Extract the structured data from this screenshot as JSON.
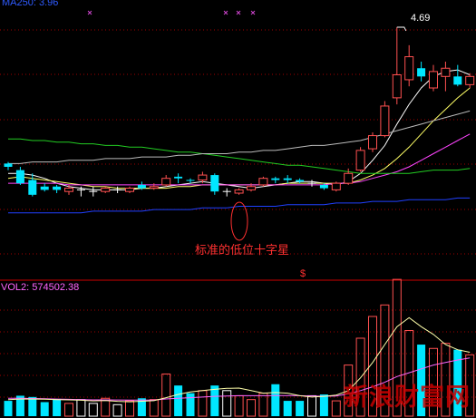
{
  "header": {
    "ma_label": "MA250: 3.96",
    "ma_color": "#2f5bff"
  },
  "annotation": {
    "text": "标准的低位十字星",
    "color": "#ff3030"
  },
  "peak": {
    "text": "4.69"
  },
  "volume": {
    "label": "VOL2: 574502.38",
    "color": "#ff66ff"
  },
  "watermark": {
    "text": "新浪财富网",
    "color": "#c80000"
  },
  "marker": {
    "text": "$",
    "color": "#ff3030"
  },
  "colors": {
    "up": "#ff5050",
    "down": "#00e6ff",
    "doji": "#ffffff",
    "ma5": "#ffffff",
    "ma10": "#ffff66",
    "ma20": "#ff44ff",
    "ma60": "#22cc22",
    "ma120": "#bbbbbb",
    "ma250": "#2040ff",
    "grid": "#a00000"
  },
  "chart_data": [
    {
      "type": "candlestick",
      "title": "",
      "ylim": [
        3.2,
        4.8
      ],
      "grid": true,
      "candles": [
        {
          "o": 3.86,
          "h": 3.87,
          "c": 3.84,
          "l": 3.82,
          "dir": "down"
        },
        {
          "o": 3.82,
          "h": 3.84,
          "c": 3.74,
          "l": 3.73,
          "dir": "down"
        },
        {
          "o": 3.76,
          "h": 3.8,
          "c": 3.67,
          "l": 3.66,
          "dir": "down"
        },
        {
          "o": 3.72,
          "h": 3.74,
          "c": 3.7,
          "l": 3.69,
          "dir": "down"
        },
        {
          "o": 3.72,
          "h": 3.73,
          "c": 3.7,
          "l": 3.68,
          "dir": "down"
        },
        {
          "o": 3.71,
          "h": 3.73,
          "c": 3.69,
          "l": 3.67,
          "dir": "up"
        },
        {
          "o": 3.7,
          "h": 3.72,
          "c": 3.7,
          "l": 3.66,
          "dir": "doji"
        },
        {
          "o": 3.69,
          "h": 3.72,
          "c": 3.69,
          "l": 3.66,
          "dir": "doji"
        },
        {
          "o": 3.69,
          "h": 3.72,
          "c": 3.71,
          "l": 3.68,
          "dir": "up"
        },
        {
          "o": 3.7,
          "h": 3.72,
          "c": 3.7,
          "l": 3.68,
          "dir": "doji"
        },
        {
          "o": 3.69,
          "h": 3.72,
          "c": 3.71,
          "l": 3.68,
          "dir": "up"
        },
        {
          "o": 3.73,
          "h": 3.75,
          "c": 3.71,
          "l": 3.7,
          "dir": "down"
        },
        {
          "o": 3.71,
          "h": 3.74,
          "c": 3.72,
          "l": 3.7,
          "dir": "up"
        },
        {
          "o": 3.73,
          "h": 3.79,
          "c": 3.77,
          "l": 3.72,
          "dir": "up"
        },
        {
          "o": 3.78,
          "h": 3.8,
          "c": 3.77,
          "l": 3.74,
          "dir": "down"
        },
        {
          "o": 3.76,
          "h": 3.77,
          "c": 3.76,
          "l": 3.74,
          "dir": "down"
        },
        {
          "o": 3.76,
          "h": 3.81,
          "c": 3.79,
          "l": 3.74,
          "dir": "up"
        },
        {
          "o": 3.79,
          "h": 3.8,
          "c": 3.69,
          "l": 3.67,
          "dir": "down"
        },
        {
          "o": 3.69,
          "h": 3.71,
          "c": 3.69,
          "l": 3.66,
          "dir": "doji"
        },
        {
          "o": 3.68,
          "h": 3.71,
          "c": 3.7,
          "l": 3.67,
          "dir": "up"
        },
        {
          "o": 3.7,
          "h": 3.74,
          "c": 3.72,
          "l": 3.69,
          "dir": "up"
        },
        {
          "o": 3.73,
          "h": 3.78,
          "c": 3.77,
          "l": 3.72,
          "dir": "up"
        },
        {
          "o": 3.77,
          "h": 3.78,
          "c": 3.76,
          "l": 3.74,
          "dir": "down"
        },
        {
          "o": 3.77,
          "h": 3.79,
          "c": 3.76,
          "l": 3.74,
          "dir": "down"
        },
        {
          "o": 3.76,
          "h": 3.77,
          "c": 3.75,
          "l": 3.74,
          "dir": "down"
        },
        {
          "o": 3.74,
          "h": 3.76,
          "c": 3.74,
          "l": 3.72,
          "dir": "doji"
        },
        {
          "o": 3.73,
          "h": 3.74,
          "c": 3.71,
          "l": 3.7,
          "dir": "down"
        },
        {
          "o": 3.7,
          "h": 3.75,
          "c": 3.74,
          "l": 3.69,
          "dir": "up"
        },
        {
          "o": 3.74,
          "h": 3.83,
          "c": 3.8,
          "l": 3.73,
          "dir": "up"
        },
        {
          "o": 3.82,
          "h": 3.96,
          "c": 3.94,
          "l": 3.81,
          "dir": "up"
        },
        {
          "o": 3.95,
          "h": 4.05,
          "c": 4.03,
          "l": 3.93,
          "dir": "up"
        },
        {
          "o": 4.03,
          "h": 4.24,
          "c": 4.21,
          "l": 4.02,
          "dir": "up"
        },
        {
          "o": 4.26,
          "h": 4.69,
          "c": 4.4,
          "l": 4.22,
          "dir": "up"
        },
        {
          "o": 4.37,
          "h": 4.58,
          "c": 4.51,
          "l": 4.33,
          "dir": "up"
        },
        {
          "o": 4.44,
          "h": 4.48,
          "c": 4.39,
          "l": 4.36,
          "dir": "down"
        },
        {
          "o": 4.42,
          "h": 4.46,
          "c": 4.32,
          "l": 4.3,
          "dir": "up"
        },
        {
          "o": 4.39,
          "h": 4.48,
          "c": 4.44,
          "l": 4.3,
          "dir": "up"
        },
        {
          "o": 4.39,
          "h": 4.46,
          "c": 4.34,
          "l": 4.33,
          "dir": "down"
        },
        {
          "o": 4.34,
          "h": 4.41,
          "c": 4.39,
          "l": 4.32,
          "dir": "up"
        }
      ],
      "ma": [
        {
          "name": "MA5",
          "color": "#ffffff",
          "values": [
            3.8,
            3.8,
            3.79,
            3.77,
            3.74,
            3.72,
            3.71,
            3.7,
            3.7,
            3.7,
            3.7,
            3.71,
            3.71,
            3.72,
            3.73,
            3.74,
            3.75,
            3.74,
            3.73,
            3.72,
            3.71,
            3.72,
            3.73,
            3.74,
            3.75,
            3.75,
            3.74,
            3.73,
            3.75,
            3.8,
            3.88,
            3.97,
            4.1,
            4.22,
            4.32,
            4.39,
            4.42,
            4.43,
            4.4
          ]
        },
        {
          "name": "MA10",
          "color": "#ffff66",
          "values": [
            3.77,
            3.78,
            3.77,
            3.76,
            3.75,
            3.74,
            3.73,
            3.72,
            3.72,
            3.71,
            3.71,
            3.71,
            3.71,
            3.71,
            3.72,
            3.72,
            3.73,
            3.73,
            3.73,
            3.73,
            3.73,
            3.73,
            3.73,
            3.74,
            3.74,
            3.74,
            3.74,
            3.74,
            3.74,
            3.76,
            3.79,
            3.83,
            3.89,
            3.96,
            4.04,
            4.12,
            4.19,
            4.26,
            4.32
          ]
        },
        {
          "name": "MA20",
          "color": "#ff44ff",
          "values": [
            3.74,
            3.74,
            3.74,
            3.74,
            3.74,
            3.73,
            3.73,
            3.73,
            3.73,
            3.73,
            3.73,
            3.73,
            3.73,
            3.73,
            3.73,
            3.73,
            3.73,
            3.73,
            3.73,
            3.73,
            3.73,
            3.73,
            3.73,
            3.73,
            3.73,
            3.73,
            3.73,
            3.74,
            3.74,
            3.75,
            3.77,
            3.79,
            3.81,
            3.84,
            3.88,
            3.92,
            3.96,
            4.0,
            4.04
          ]
        },
        {
          "name": "MA60",
          "color": "#22cc22",
          "values": [
            4.01,
            4.01,
            4.0,
            4.0,
            3.99,
            3.99,
            3.98,
            3.98,
            3.97,
            3.97,
            3.96,
            3.96,
            3.95,
            3.94,
            3.93,
            3.93,
            3.92,
            3.91,
            3.9,
            3.89,
            3.88,
            3.87,
            3.86,
            3.85,
            3.85,
            3.84,
            3.83,
            3.82,
            3.81,
            3.8,
            3.8,
            3.8,
            3.8,
            3.8,
            3.81,
            3.82,
            3.82,
            3.82,
            3.83
          ]
        },
        {
          "name": "MA120",
          "color": "#bbbbbb",
          "values": [
            3.86,
            3.86,
            3.87,
            3.87,
            3.87,
            3.88,
            3.88,
            3.88,
            3.89,
            3.89,
            3.89,
            3.9,
            3.9,
            3.9,
            3.91,
            3.91,
            3.92,
            3.92,
            3.92,
            3.93,
            3.93,
            3.94,
            3.94,
            3.95,
            3.96,
            3.97,
            3.97,
            3.98,
            3.99,
            4.0,
            4.02,
            4.04,
            4.06,
            4.08,
            4.1,
            4.12,
            4.14,
            4.16,
            4.18
          ]
        },
        {
          "name": "MA250",
          "color": "#2040ff",
          "values": [
            3.56,
            3.56,
            3.56,
            3.56,
            3.56,
            3.56,
            3.56,
            3.57,
            3.57,
            3.57,
            3.57,
            3.57,
            3.58,
            3.58,
            3.58,
            3.58,
            3.59,
            3.59,
            3.59,
            3.6,
            3.6,
            3.6,
            3.6,
            3.61,
            3.61,
            3.61,
            3.61,
            3.62,
            3.62,
            3.62,
            3.63,
            3.63,
            3.63,
            3.64,
            3.64,
            3.64,
            3.64,
            3.65,
            3.65
          ]
        }
      ]
    },
    {
      "type": "bar",
      "title": "",
      "ylim": [
        0,
        1000000
      ],
      "values": [
        120000,
        160000,
        150000,
        110000,
        130000,
        100000,
        130000,
        100000,
        140000,
        90000,
        120000,
        140000,
        130000,
        330000,
        240000,
        180000,
        200000,
        240000,
        200000,
        160000,
        130000,
        180000,
        250000,
        120000,
        120000,
        160000,
        170000,
        120000,
        400000,
        610000,
        780000,
        870000,
        1070000,
        670000,
        560000,
        530000,
        570000,
        520000,
        480000
      ],
      "dirs": [
        "down",
        "down",
        "down",
        "down",
        "down",
        "up",
        "doji",
        "doji",
        "up",
        "doji",
        "up",
        "down",
        "up",
        "up",
        "down",
        "down",
        "up",
        "down",
        "doji",
        "up",
        "up",
        "up",
        "down",
        "down",
        "down",
        "doji",
        "down",
        "up",
        "up",
        "up",
        "up",
        "up",
        "up",
        "up",
        "down",
        "up",
        "up",
        "down",
        "up"
      ],
      "series": [
        {
          "name": "VOL2",
          "color": "#ff66ff",
          "values": [
            140000,
            140000,
            138000,
            136000,
            134000,
            132000,
            130000,
            128000,
            128000,
            127000,
            126000,
            126000,
            126000,
            135000,
            140000,
            145000,
            150000,
            155000,
            158000,
            160000,
            160000,
            160000,
            162000,
            162000,
            160000,
            158000,
            156000,
            158000,
            175000,
            200000,
            230000,
            265000,
            310000,
            340000,
            370000,
            400000,
            420000,
            440000,
            455000
          ]
        },
        {
          "name": "MA",
          "color": "#ffffaa",
          "values": [
            130000,
            134000,
            134000,
            133000,
            130000,
            128000,
            125000,
            120000,
            122000,
            116000,
            113000,
            117000,
            121000,
            145000,
            170000,
            190000,
            200000,
            210000,
            218000,
            220000,
            200000,
            180000,
            185000,
            180000,
            160000,
            150000,
            155000,
            165000,
            200000,
            300000,
            420000,
            560000,
            700000,
            770000,
            700000,
            640000,
            560000,
            520000,
            500000
          ]
        }
      ]
    }
  ]
}
